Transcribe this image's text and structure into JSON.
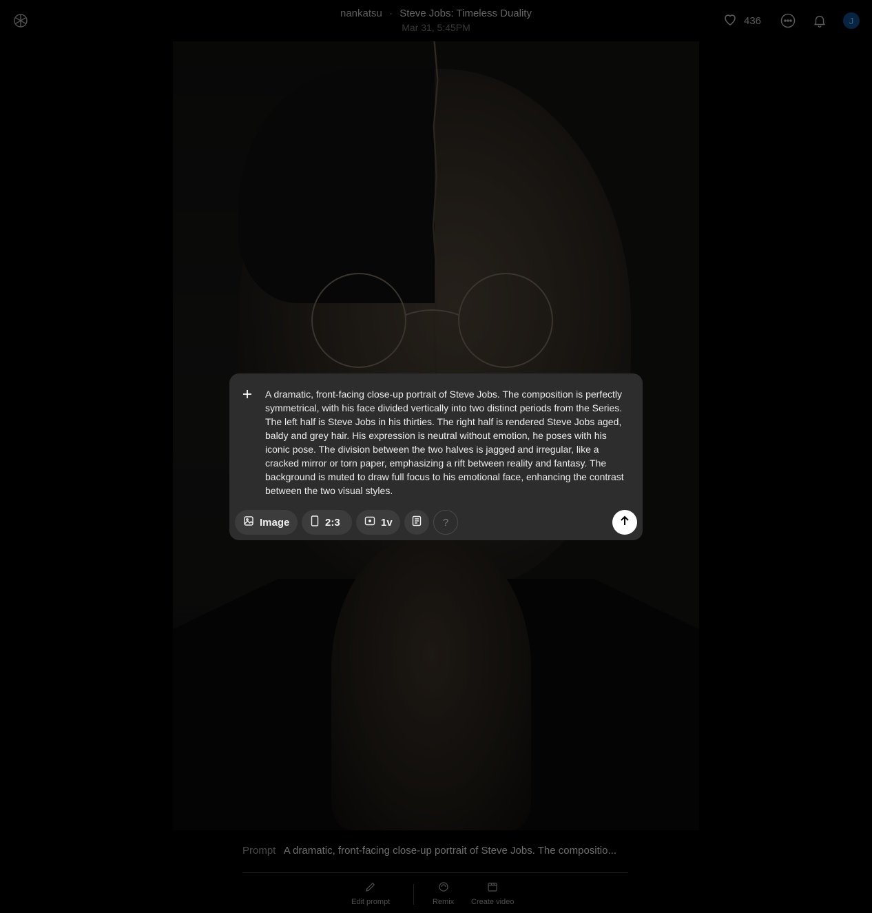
{
  "header": {
    "author": "nankatsu",
    "separator": "·",
    "title": "Steve Jobs: Timeless Duality",
    "date": "Mar 31, 5:45PM",
    "likes": "436",
    "avatar_initial": "J"
  },
  "icons": {
    "logo": "openai-logo-icon",
    "heart": "heart-icon",
    "more": "more-options-icon",
    "bell": "bell-icon"
  },
  "composer": {
    "text": "A dramatic, front-facing close-up portrait of Steve Jobs. The composition is perfectly symmetrical, with his face divided vertically into two distinct periods from the Series. The left half is Steve Jobs in his thirties. The right half is rendered Steve Jobs aged, baldy and grey hair. His expression is neutral without emotion, he poses with his iconic pose. The division between the two halves is jagged and irregular, like a cracked mirror or torn paper, emphasizing a rift between reality and fantasy. The background is muted to draw full focus to his emotional face, enhancing the contrast between the two visual styles.",
    "type_label": "Image",
    "ratio_label": "2:3",
    "variations_label": "1v",
    "help_label": "?"
  },
  "prompt_bar": {
    "label": "Prompt",
    "text": "A dramatic, front-facing close-up portrait of Steve Jobs. The compositio..."
  },
  "actions": {
    "edit": "Edit prompt",
    "remix": "Remix",
    "video": "Create video"
  },
  "colors": {
    "background": "#000000",
    "composer_bg": "#2d2d2d",
    "chip_bg": "#3c3c3c",
    "avatar_bg": "#0b3a66"
  }
}
